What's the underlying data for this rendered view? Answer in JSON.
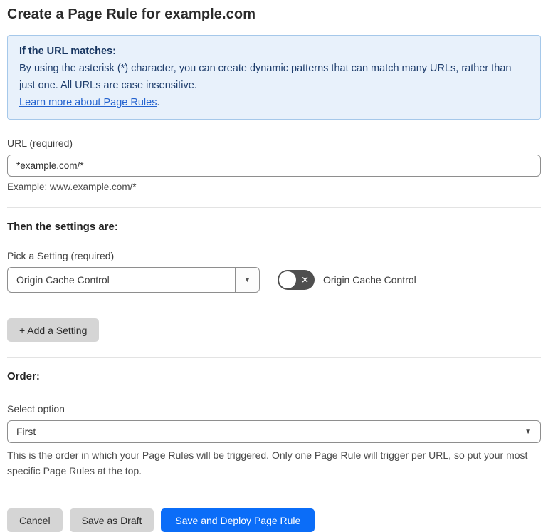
{
  "page": {
    "title": "Create a Page Rule for example.com"
  },
  "info_box": {
    "heading": "If the URL matches:",
    "body": "By using the asterisk (*) character, you can create dynamic patterns that can match many URLs, rather than just one. All URLs are case insensitive.",
    "link_text": "Learn more about Page Rules",
    "link_suffix": "."
  },
  "url_section": {
    "label": "URL (required)",
    "value": "*example.com/*",
    "example": "Example: www.example.com/*"
  },
  "settings_section": {
    "heading": "Then the settings are:",
    "pick_label": "Pick a Setting (required)",
    "selected_setting": "Origin Cache Control",
    "toggle_state": "off",
    "toggle_label": "Origin Cache Control",
    "add_button_label": "+ Add a Setting"
  },
  "order_section": {
    "heading": "Order:",
    "label": "Select option",
    "selected_option": "First",
    "help": "This is the order in which your Page Rules will be triggered. Only one Page Rule will trigger per URL, so put your most specific Page Rules at the top."
  },
  "footer": {
    "cancel_label": "Cancel",
    "save_draft_label": "Save as Draft",
    "save_deploy_label": "Save and Deploy Page Rule"
  },
  "icons": {
    "dropdown_arrow": "▼",
    "toggle_off_x": "✕"
  },
  "colors": {
    "accent_blue": "#0b6df8",
    "info_bg": "#e8f1fb",
    "info_border": "#a5c8ea",
    "info_text": "#1d3c6b",
    "link_blue": "#2463cf",
    "toggle_off_bg": "#4f4f4f",
    "button_gray": "#d5d5d5",
    "divider": "#e3e3e3"
  }
}
